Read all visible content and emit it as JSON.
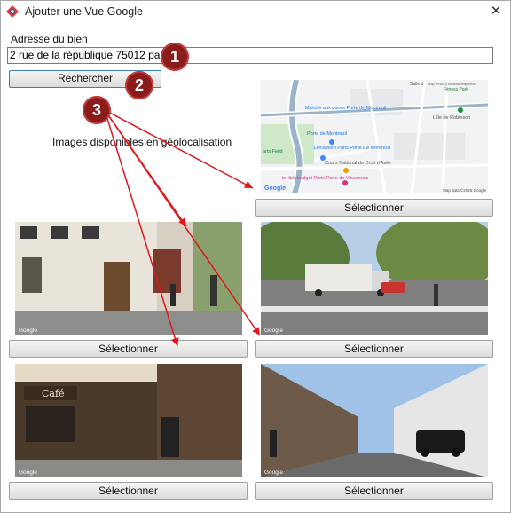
{
  "window": {
    "title": "Ajouter une Vue Google"
  },
  "address": {
    "label": "Adresse du bien",
    "value": "2 rue de la république 75012 paris"
  },
  "search_button": "Rechercher",
  "geo_label": "Images disponibles en géolocalisation",
  "select_label": "Sélectionner",
  "watermark": "Google",
  "map": {
    "labels": {
      "salle": "Salle d",
      "error": "Map error: g.co/staticmaperror",
      "fitness": "Fitness Park",
      "marche": "Marché aux puces Porte de Montreuil",
      "porte": "Porte de Montreuil",
      "decathlon": "Decathlon Paris Porte De Montreuil",
      "fields": "arts Field",
      "cours": "Cours National du Droit d'Asile",
      "hotel": "tel ibis budget Paris Porte de Vincennes",
      "lile": "L'Île de Robinson",
      "rue_pv": "Rue de Paris",
      "rue_dd": "Rue Douy Delcupe",
      "rue_b": "Rue Barbès",
      "rue_m": "Rue Marceau",
      "rue_mi": "Rue Michelet",
      "rue_d": "Rue Diderot",
      "mapdata": "Map data ©2025 Google"
    }
  },
  "annotations": [
    "1",
    "2",
    "3"
  ],
  "cafe_sign": "Café",
  "colors": {
    "badge": "#8a1c1c",
    "arrow": "#e0161b",
    "button_border": "#a0a0a0"
  }
}
